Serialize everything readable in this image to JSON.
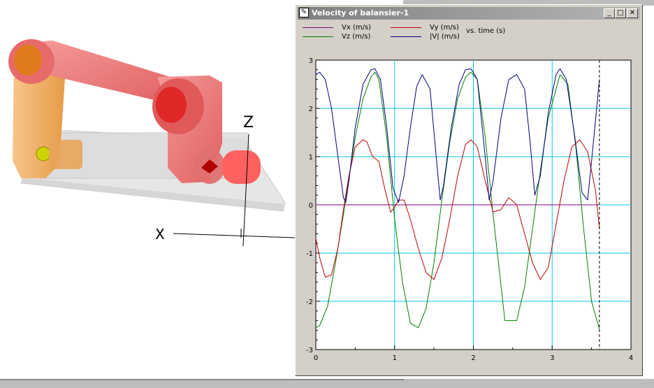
{
  "window": {
    "title": "Velocity of balansier-1",
    "icon": "pen-icon",
    "icon_glyph": "✎",
    "minimize_glyph": "_",
    "maximize_glyph": "□",
    "close_glyph": "✕"
  },
  "viewport": {
    "axis_z_label": "Z",
    "axis_x_label": "X"
  },
  "legend": {
    "entries": [
      {
        "label": "Vx (m/s)",
        "color": "#800080"
      },
      {
        "label": "Vz (m/s)",
        "color": "#008000"
      },
      {
        "label": "Vy (m/s)",
        "color": "#c00000"
      },
      {
        "label": "|V| (m/s)",
        "color": "#000080"
      }
    ],
    "xaxis_note": "vs. time (s)"
  },
  "chart_data": {
    "type": "line",
    "xlim": [
      0,
      4
    ],
    "ylim": [
      -3,
      3
    ],
    "xticks": [
      "0",
      "1",
      "2",
      "3",
      "4"
    ],
    "yticks": [
      "3",
      "2",
      "1",
      "0",
      "-1",
      "-2",
      "-3"
    ],
    "grid": true,
    "grid_color": "#00c8e6",
    "cursor_x": 3.6,
    "series": [
      {
        "name": "Vx (m/s)",
        "color": "#800080",
        "x": [
          0,
          3.6
        ],
        "y": [
          0,
          0
        ]
      },
      {
        "name": "Vz (m/s)",
        "color": "#008000",
        "x": [
          0,
          0.05,
          0.15,
          0.25,
          0.35,
          0.4,
          0.5,
          0.6,
          0.7,
          0.75,
          0.8,
          0.9,
          1.0,
          1.1,
          1.2,
          1.3,
          1.4,
          1.5,
          1.6,
          1.7,
          1.8,
          1.9,
          1.97,
          2.05,
          2.15,
          2.25,
          2.4,
          2.55,
          2.65,
          2.75,
          2.85,
          2.95,
          3.1,
          3.2,
          3.3,
          3.4,
          3.5,
          3.6
        ],
        "y": [
          -2.55,
          -2.5,
          -2.1,
          -1.2,
          -0.2,
          0.35,
          1.4,
          2.2,
          2.65,
          2.75,
          2.6,
          1.4,
          -0.3,
          -1.6,
          -2.45,
          -2.55,
          -2.15,
          -1.2,
          0.1,
          1.3,
          2.2,
          2.65,
          2.75,
          2.6,
          1.4,
          -0.2,
          -2.4,
          -2.4,
          -1.7,
          -0.5,
          0.7,
          1.8,
          2.7,
          2.5,
          1.2,
          -0.5,
          -2.0,
          -2.58
        ]
      },
      {
        "name": "Vy (m/s)",
        "color": "#c00000",
        "x": [
          0,
          0.05,
          0.12,
          0.2,
          0.28,
          0.35,
          0.42,
          0.5,
          0.6,
          0.65,
          0.72,
          0.8,
          0.88,
          0.95,
          1.0,
          1.05,
          1.12,
          1.2,
          1.3,
          1.4,
          1.5,
          1.6,
          1.7,
          1.8,
          1.9,
          1.97,
          2.05,
          2.15,
          2.25,
          2.35,
          2.45,
          2.55,
          2.65,
          2.75,
          2.85,
          2.95,
          3.05,
          3.15,
          3.25,
          3.35,
          3.45,
          3.55,
          3.6
        ],
        "y": [
          -0.7,
          -1.1,
          -1.5,
          -1.45,
          -0.9,
          -0.1,
          0.6,
          1.2,
          1.35,
          1.3,
          1.0,
          0.9,
          0.3,
          -0.15,
          -0.05,
          0.1,
          0.1,
          -0.3,
          -0.9,
          -1.4,
          -1.55,
          -1.1,
          -0.3,
          0.6,
          1.25,
          1.35,
          1.2,
          0.5,
          -0.15,
          -0.1,
          0.15,
          0.0,
          -0.6,
          -1.2,
          -1.55,
          -1.3,
          -0.4,
          0.5,
          1.2,
          1.35,
          1.1,
          0.3,
          -0.5
        ]
      },
      {
        "name": "|V| (m/s)",
        "color": "#000080",
        "x": [
          0,
          0.05,
          0.12,
          0.2,
          0.28,
          0.35,
          0.38,
          0.42,
          0.5,
          0.6,
          0.7,
          0.75,
          0.82,
          0.9,
          0.98,
          1.05,
          1.12,
          1.2,
          1.28,
          1.35,
          1.45,
          1.55,
          1.58,
          1.62,
          1.72,
          1.82,
          1.9,
          1.97,
          2.05,
          2.15,
          2.2,
          2.25,
          2.35,
          2.45,
          2.55,
          2.65,
          2.72,
          2.78,
          2.85,
          2.95,
          3.05,
          3.1,
          3.18,
          3.28,
          3.38,
          3.45,
          3.5,
          3.6
        ],
        "y": [
          2.7,
          2.75,
          2.6,
          2.0,
          1.0,
          0.15,
          0.05,
          0.5,
          1.6,
          2.5,
          2.8,
          2.82,
          2.6,
          1.6,
          0.35,
          0.05,
          0.6,
          1.6,
          2.45,
          2.7,
          2.4,
          0.6,
          0.1,
          0.4,
          1.6,
          2.5,
          2.8,
          2.82,
          2.6,
          1.0,
          0.1,
          0.5,
          1.8,
          2.6,
          2.7,
          2.4,
          1.3,
          0.2,
          0.6,
          1.9,
          2.7,
          2.82,
          2.6,
          1.5,
          0.25,
          0.1,
          0.9,
          2.6
        ]
      }
    ]
  }
}
